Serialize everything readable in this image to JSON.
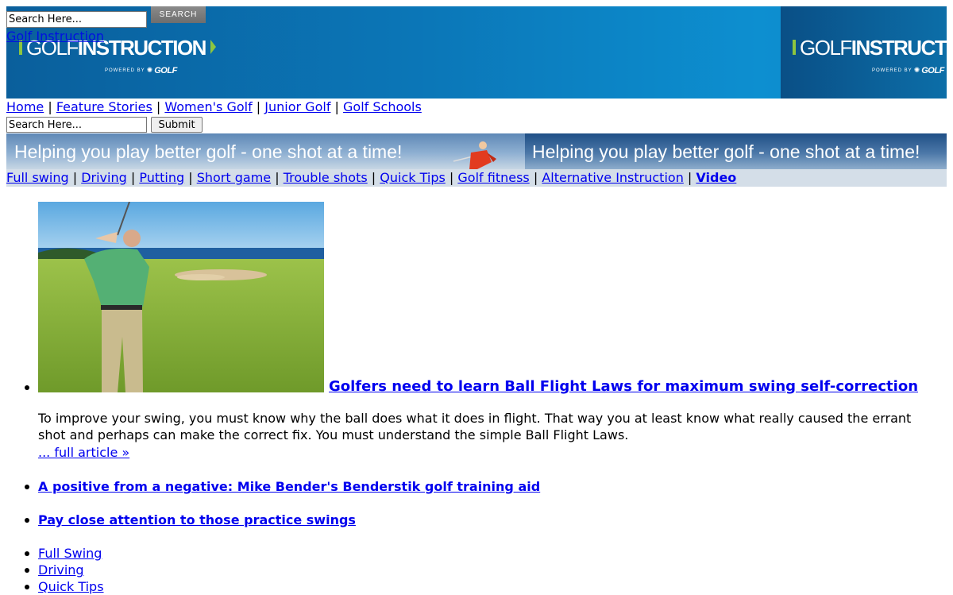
{
  "header": {
    "search": {
      "placeholder": "Search Here...",
      "button_label": "SEARCH"
    },
    "overlap_link": "Golf Instruction",
    "logo": {
      "part1": "GOLF",
      "part2": "INSTRUCTION",
      "powered_by": "POWERED BY",
      "brand": "GOLF"
    }
  },
  "main_nav": [
    "Home",
    "Feature Stories",
    "Women's Golf",
    "Junior Golf",
    "Golf Schools"
  ],
  "search_form": {
    "placeholder": "Search Here...",
    "button_label": "Submit"
  },
  "tagline": "Helping you play better golf - one shot at a time!",
  "sub_nav": [
    "Full swing",
    "Driving",
    "Putting",
    "Short game",
    "Trouble shots",
    "Quick Tips",
    "Golf fitness",
    "Alternative Instruction",
    "Video"
  ],
  "featured": {
    "title": "Golfers need to learn Ball Flight Laws for maximum swing self-correction",
    "summary": "To improve your swing, you must know why the ball does what it does in flight. That way you at least know what really caused the errant shot and perhaps can make the correct fix. You must understand the simple Ball Flight Laws.",
    "more_link": "... full article »"
  },
  "stories": [
    "A positive from a negative: Mike Bender's Benderstik golf training aid",
    "Pay close attention to those practice swings"
  ],
  "categories": [
    "Full Swing",
    "Driving",
    "Quick Tips"
  ],
  "colors": {
    "link": "#0000ee",
    "banner": "#0b77b8",
    "accent_green": "#8dc63f",
    "subnav_bg": "#d4dee8"
  },
  "icons": {
    "logo_mark": "green-bar-arrow",
    "network": "peacock-icon"
  }
}
